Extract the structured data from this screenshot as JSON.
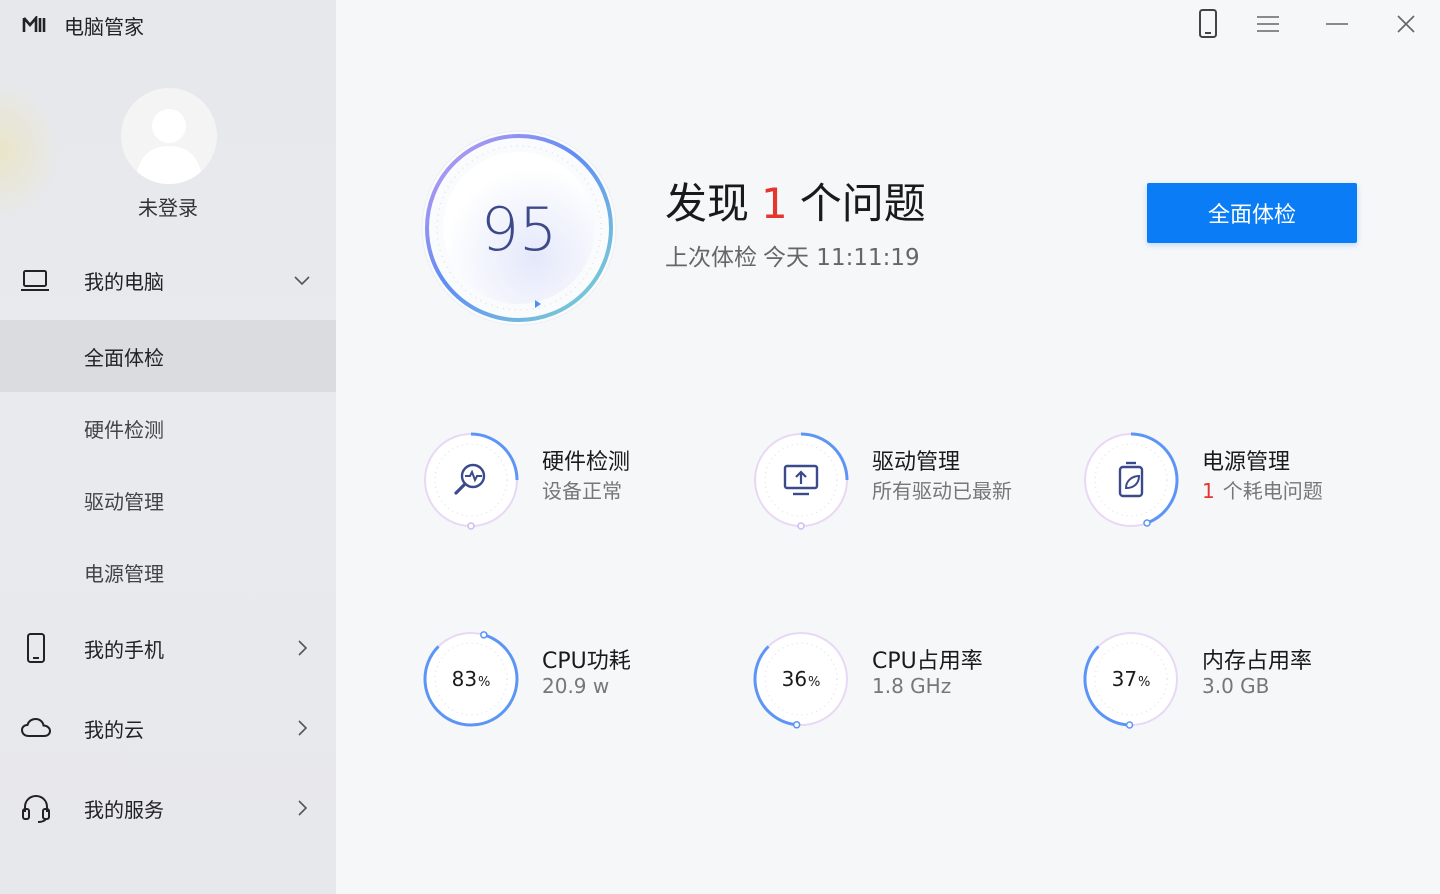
{
  "app": {
    "title": "电脑管家"
  },
  "user": {
    "name": "未登录"
  },
  "sidebar": {
    "sections": [
      {
        "label": "我的电脑",
        "icon": "laptop-icon",
        "expanded": true
      },
      {
        "label": "我的手机",
        "icon": "phone-icon"
      },
      {
        "label": "我的云",
        "icon": "cloud-icon"
      },
      {
        "label": "我的服务",
        "icon": "headset-icon"
      }
    ],
    "sub_items": [
      {
        "label": "全面体检",
        "active": true
      },
      {
        "label": "硬件检测"
      },
      {
        "label": "驱动管理"
      },
      {
        "label": "电源管理"
      }
    ]
  },
  "score": {
    "value": "95",
    "headline_prefix": "发现",
    "issue_count": "1",
    "headline_suffix": "个问题",
    "last_check_label": "上次体检",
    "last_check_time": "今天 11:11:19",
    "action_label": "全面体检"
  },
  "cards": [
    {
      "title": "硬件检测",
      "subtitle": "设备正常",
      "icon": "hardware-scan-icon"
    },
    {
      "title": "驱动管理",
      "subtitle": "所有驱动已最新",
      "icon": "driver-update-icon"
    },
    {
      "title": "电源管理",
      "alert": "1",
      "subtitle": "个耗电问题",
      "icon": "battery-leaf-icon"
    }
  ],
  "metrics": [
    {
      "title": "CPU功耗",
      "value": "83",
      "unit": "%",
      "subtitle": "20.9 w",
      "level": 0.83
    },
    {
      "title": "CPU占用率",
      "value": "36",
      "unit": "%",
      "subtitle": "1.8 GHz",
      "level": 0.36
    },
    {
      "title": "内存占用率",
      "value": "37",
      "unit": "%",
      "subtitle": "3.0 GB",
      "level": 0.37
    }
  ],
  "colors": {
    "accent": "#0a7cf5",
    "alert": "#e5352f",
    "ring_blue": "#4f8ef7",
    "ring_purple": "#c8a8ee"
  }
}
